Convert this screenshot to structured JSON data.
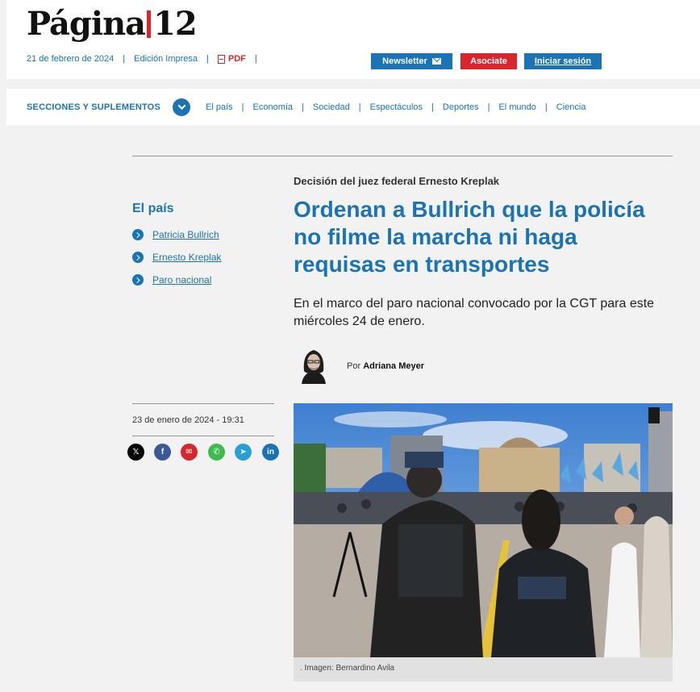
{
  "header": {
    "logo_left": "Página",
    "logo_right": "12",
    "date": "21 de febrero de 2024",
    "edition_link": "Edición Impresa",
    "pdf_label": "PDF",
    "newsletter_button": "Newsletter",
    "associate_button": "Asociate",
    "login_button": "Iniciar sesión"
  },
  "nav": {
    "title": "SECCIONES Y SUPLEMENTOS",
    "links": [
      "El país",
      "Economía",
      "Sociedad",
      "Espectáculos",
      "Deportes",
      "El mundo",
      "Ciencia"
    ]
  },
  "sidebar": {
    "section_title": "El país",
    "tags": [
      "Patricia Bullrich",
      "Ernesto Kreplak",
      "Paro nacional"
    ],
    "published": "23 de enero de 2024 - 19:31",
    "share_icons": [
      "x-icon",
      "facebook-icon",
      "email-icon",
      "whatsapp-icon",
      "telegram-icon",
      "linkedin-icon"
    ]
  },
  "article": {
    "kicker": "Decisión del juez federal Ernesto Kreplak",
    "headline": "Ordenan a Bullrich que la policía no filme la marcha ni haga requisas en transportes",
    "summary": "En el marco del paro nacional convocado por la CGT para este miércoles 24 de enero.",
    "author_prefix": "Por",
    "author_name": "Adriana Meyer",
    "image_caption": ". Imagen: Bernardino Avila"
  },
  "colors": {
    "brand_blue": "#1a73b5",
    "brand_red": "#d8262e",
    "background": "#f2f2f2"
  }
}
